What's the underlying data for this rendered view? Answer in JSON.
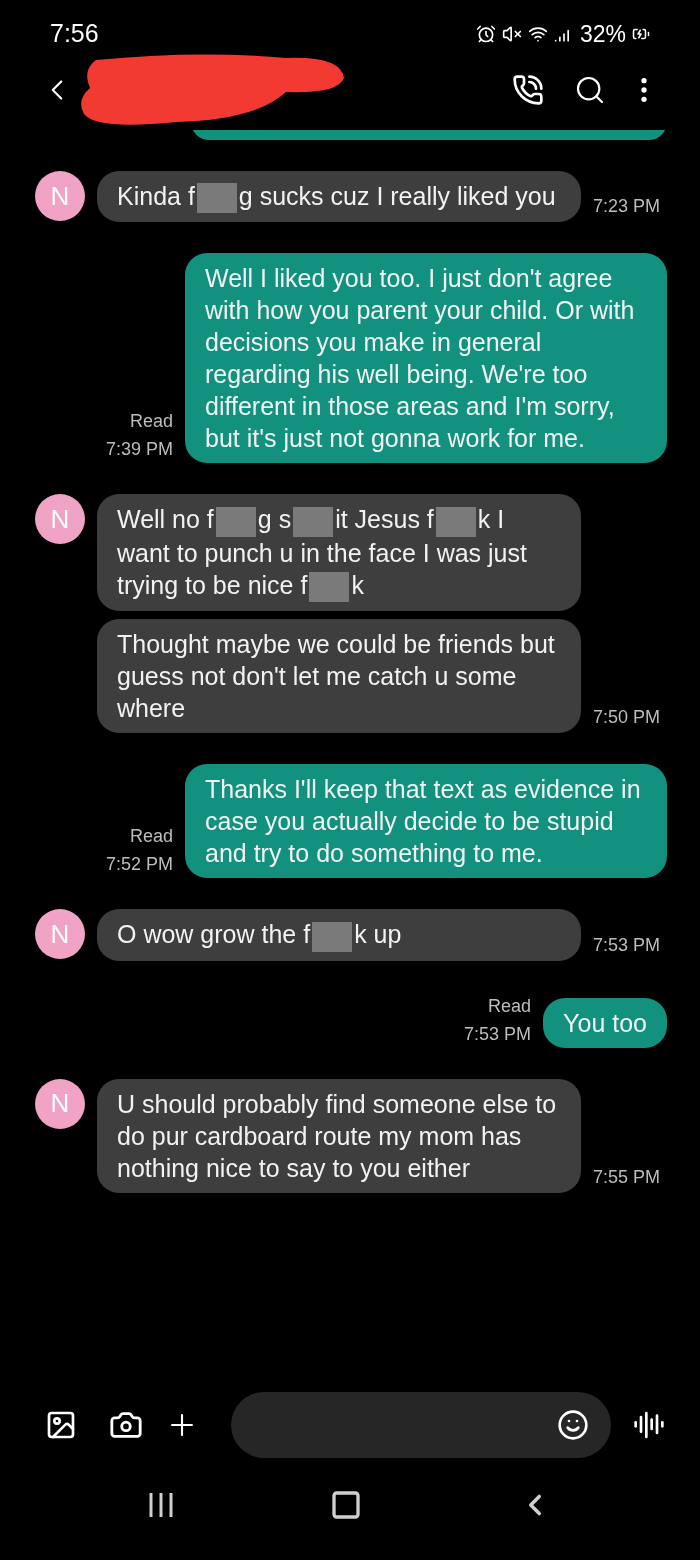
{
  "status_bar": {
    "time": "7:56",
    "battery": "32%"
  },
  "messages": [
    {
      "kind": "incoming",
      "avatar": "N",
      "parts": [
        {
          "kind": "text",
          "text": "Kinda f"
        },
        {
          "kind": "censor"
        },
        {
          "kind": "text",
          "text": "g sucks cuz I really liked you"
        }
      ],
      "time": "7:23 PM"
    },
    {
      "kind": "outgoing",
      "parts": [
        {
          "kind": "text",
          "text": "Well I liked you too. I just don't agree with how you parent your child. Or with decisions you make in general regarding his well being. We're too different in those areas and I'm sorry, but it's just not gonna work for me."
        }
      ],
      "read": "Read",
      "time": "7:39 PM"
    },
    {
      "kind": "incoming",
      "avatar": "N",
      "parts": [
        {
          "kind": "text",
          "text": "Well no f"
        },
        {
          "kind": "censor"
        },
        {
          "kind": "text",
          "text": "g s"
        },
        {
          "kind": "censor"
        },
        {
          "kind": "text",
          "text": "it Jesus f"
        },
        {
          "kind": "censor"
        },
        {
          "kind": "text",
          "text": "k I want to punch u in the face I was just trying to be nice f"
        },
        {
          "kind": "censor"
        },
        {
          "kind": "text",
          "text": "k"
        }
      ]
    },
    {
      "kind": "incoming",
      "parts": [
        {
          "kind": "text",
          "text": "Thought maybe we could be friends but guess not don't let me catch u some where"
        }
      ],
      "time": "7:50 PM"
    },
    {
      "kind": "outgoing",
      "parts": [
        {
          "kind": "text",
          "text": "Thanks I'll keep that text as evidence in case you actually decide to be stupid and try to do something to me."
        }
      ],
      "read": "Read",
      "time": "7:52 PM"
    },
    {
      "kind": "incoming",
      "avatar": "N",
      "parts": [
        {
          "kind": "text",
          "text": "O wow grow the f"
        },
        {
          "kind": "censor"
        },
        {
          "kind": "text",
          "text": "k up"
        }
      ],
      "time": "7:53 PM"
    },
    {
      "kind": "outgoing",
      "parts": [
        {
          "kind": "text",
          "text": "You too"
        }
      ],
      "read": "Read",
      "time": "7:53 PM"
    },
    {
      "kind": "incoming",
      "avatar": "N",
      "parts": [
        {
          "kind": "text",
          "text": "U should probably find someone else to do pur cardboard route my mom has nothing nice to say to you either"
        }
      ],
      "time": "7:55 PM"
    }
  ]
}
